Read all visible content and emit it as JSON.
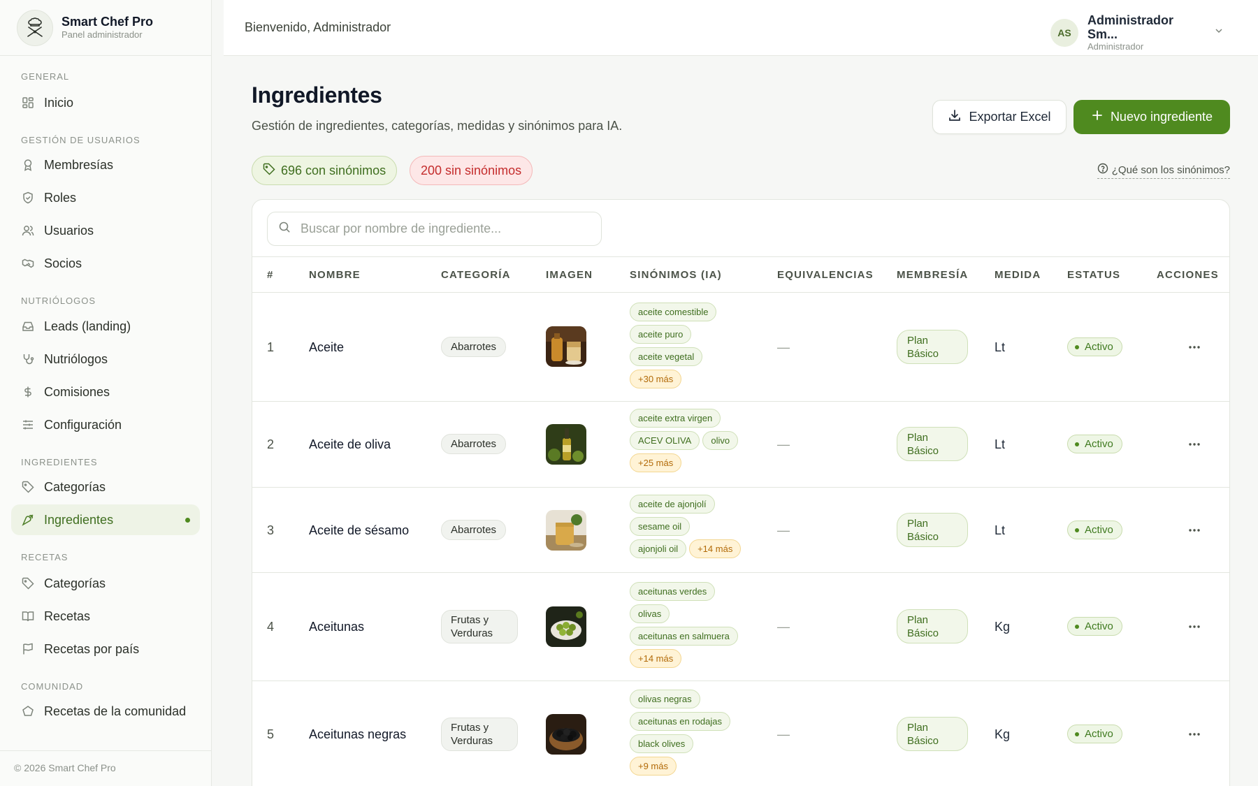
{
  "brand": {
    "name": "Smart Chef Pro",
    "subtitle": "Panel administrador"
  },
  "sidebar": {
    "sections": [
      {
        "title": "GENERAL",
        "items": [
          {
            "label": "Inicio",
            "icon": "dashboard-icon"
          }
        ]
      },
      {
        "title": "GESTIÓN DE USUARIOS",
        "items": [
          {
            "label": "Membresías",
            "icon": "award-icon"
          },
          {
            "label": "Roles",
            "icon": "shield-icon"
          },
          {
            "label": "Usuarios",
            "icon": "users-icon"
          },
          {
            "label": "Socios",
            "icon": "handshake-icon"
          }
        ]
      },
      {
        "title": "NUTRIÓLOGOS",
        "items": [
          {
            "label": "Leads (landing)",
            "icon": "inbox-icon"
          },
          {
            "label": "Nutriólogos",
            "icon": "stethoscope-icon"
          },
          {
            "label": "Comisiones",
            "icon": "dollar-icon"
          },
          {
            "label": "Configuración",
            "icon": "sliders-icon"
          }
        ]
      },
      {
        "title": "INGREDIENTES",
        "items": [
          {
            "label": "Categorías",
            "icon": "tag-icon"
          },
          {
            "label": "Ingredientes",
            "icon": "carrot-icon",
            "active": true
          }
        ]
      },
      {
        "title": "RECETAS",
        "items": [
          {
            "label": "Categorías",
            "icon": "tag-icon"
          },
          {
            "label": "Recetas",
            "icon": "book-icon"
          },
          {
            "label": "Recetas por país",
            "icon": "flag-icon"
          }
        ]
      },
      {
        "title": "COMUNIDAD",
        "items": [
          {
            "label": "Recetas de la comunidad",
            "icon": "community-icon"
          }
        ]
      }
    ],
    "footer": "© 2026 Smart Chef Pro"
  },
  "topbar": {
    "welcome": "Bienvenido, Administrador",
    "user": {
      "initials": "AS",
      "name": "Administrador Sm...",
      "role": "Administrador"
    }
  },
  "page": {
    "title": "Ingredientes",
    "description": "Gestión de ingredientes, categorías, medidas y sinónimos para IA.",
    "export_label": "Exportar Excel",
    "new_label": "Nuevo ingrediente",
    "with_synonyms": "696 con sinónimos",
    "without_synonyms": "200 sin sinónimos",
    "help_link": "¿Qué son los sinónimos?",
    "search_placeholder": "Buscar por nombre de ingrediente..."
  },
  "table": {
    "columns": [
      "#",
      "NOMBRE",
      "CATEGORÍA",
      "IMAGEN",
      "SINÓNIMOS (IA)",
      "EQUIVALENCIAS",
      "MEMBRESÍA",
      "MEDIDA",
      "ESTATUS",
      "ACCIONES"
    ],
    "rows": [
      {
        "num": "1",
        "name": "Aceite",
        "category": "Abarrotes",
        "synonyms": [
          "aceite comestible",
          "aceite puro",
          "aceite vegetal"
        ],
        "more": "+30 más",
        "equivalences": "—",
        "membership": "Plan Básico",
        "measure": "Lt",
        "status": "Activo"
      },
      {
        "num": "2",
        "name": "Aceite de oliva",
        "category": "Abarrotes",
        "synonyms": [
          "aceite extra virgen",
          "ACEV OLIVA",
          "olivo"
        ],
        "more": "+25 más",
        "equivalences": "—",
        "membership": "Plan Básico",
        "measure": "Lt",
        "status": "Activo"
      },
      {
        "num": "3",
        "name": "Aceite de sésamo",
        "category": "Abarrotes",
        "synonyms": [
          "aceite de ajonjolí",
          "sesame oil",
          "ajonjoli oil"
        ],
        "more": "+14 más",
        "equivalences": "—",
        "membership": "Plan Básico",
        "measure": "Lt",
        "status": "Activo"
      },
      {
        "num": "4",
        "name": "Aceitunas",
        "category": "Frutas y Verduras",
        "synonyms": [
          "aceitunas verdes",
          "olivas",
          "aceitunas en salmuera"
        ],
        "more": "+14 más",
        "equivalences": "—",
        "membership": "Plan Básico",
        "measure": "Kg",
        "status": "Activo"
      },
      {
        "num": "5",
        "name": "Aceitunas negras",
        "category": "Frutas y Verduras",
        "synonyms": [
          "olivas negras",
          "aceitunas en rodajas",
          "black olives"
        ],
        "more": "+9 más",
        "equivalences": "—",
        "membership": "Plan Básico",
        "measure": "Kg",
        "status": "Activo"
      }
    ]
  },
  "colors": {
    "accent": "#4f8a1f",
    "danger": "#c42c2c",
    "warning": "#b26a08"
  }
}
